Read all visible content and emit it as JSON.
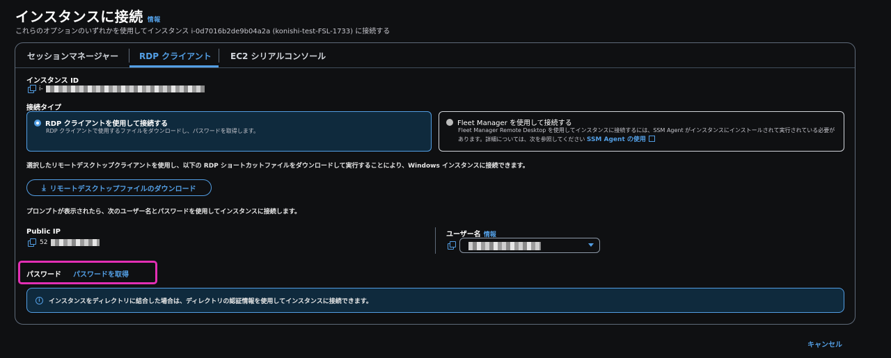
{
  "header": {
    "title": "インスタンスに接続",
    "info_link": "情報",
    "subtitle": "これらのオプションのいずれかを使用してインスタンス i-0d7016b2de9b04a2a (konishi-test-FSL-1733) に接続する"
  },
  "tabs": [
    {
      "label": "セッションマネージャー",
      "active": false
    },
    {
      "label": "RDP クライアント",
      "active": true
    },
    {
      "label": "EC2 シリアルコンソール",
      "active": false
    }
  ],
  "instance_id": {
    "label": "インスタンス ID",
    "value_prefix": "i-"
  },
  "connection_type": {
    "label": "接続タイプ",
    "options": [
      {
        "title": "RDP クライアントを使用して接続する",
        "desc": "RDP クライアントで使用するファイルをダウンロードし、パスワードを取得します。",
        "selected": true
      },
      {
        "title": "Fleet Manager を使用して接続する",
        "desc": "Fleet Manager Remote Desktop を使用してインスタンスに接続するには、SSM Agent がインスタンスにインストールされて実行されている必要があります。詳細については、次を参照してください",
        "link": "SSM Agent の使用",
        "selected": false
      }
    ]
  },
  "rdp_instructions": "選択したリモートデスクトップクライアントを使用し、以下の RDP ショートカットファイルをダウンロードして実行することにより、Windows インスタンスに接続できます。",
  "download_button": "リモートデスクトップファイルのダウンロード",
  "prompt_text": "プロンプトが表示されたら、次のユーザー名とパスワードを使用してインスタンスに接続します。",
  "public_ip": {
    "label": "Public IP",
    "value_prefix": "52"
  },
  "username": {
    "label": "ユーザー名",
    "info_link": "情報"
  },
  "password": {
    "label": "パスワード",
    "link": "パスワードを取得"
  },
  "alert": {
    "text": "インスタンスをディレクトリに結合した場合は、ディレクトリの認証情報を使用してインスタンスに接続できます。"
  },
  "footer": {
    "cancel": "キャンセル"
  },
  "colors": {
    "accent": "#539fe5",
    "highlight": "#e32fb4",
    "background": "#0f1012"
  }
}
